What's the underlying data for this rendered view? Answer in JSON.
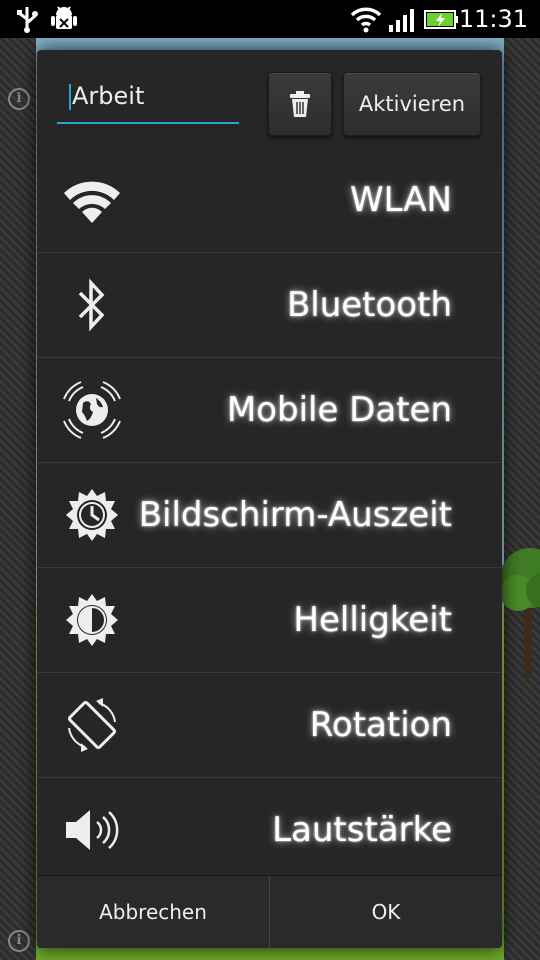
{
  "status_bar": {
    "time": "11:31",
    "icons": [
      "usb-icon",
      "android-debug-icon",
      "wifi-icon",
      "signal-icon",
      "battery-charging-icon"
    ]
  },
  "dialog": {
    "profile_name": "Arbeit",
    "delete_icon": "trash-icon",
    "activate_label": "Aktivieren",
    "items": [
      {
        "label": "WLAN",
        "icon": "wifi-icon"
      },
      {
        "label": "Bluetooth",
        "icon": "bluetooth-icon"
      },
      {
        "label": "Mobile Daten",
        "icon": "mobile-data-icon"
      },
      {
        "label": "Bildschirm-Auszeit",
        "icon": "screen-timeout-icon"
      },
      {
        "label": "Helligkeit",
        "icon": "brightness-icon"
      },
      {
        "label": "Rotation",
        "icon": "rotation-icon"
      },
      {
        "label": "Lautstärke",
        "icon": "volume-icon"
      }
    ],
    "cancel_label": "Abbrechen",
    "ok_label": "OK"
  },
  "colors": {
    "accent": "#27a8c9",
    "dialog_bg": "#262626",
    "battery_green": "#6dd02c"
  }
}
